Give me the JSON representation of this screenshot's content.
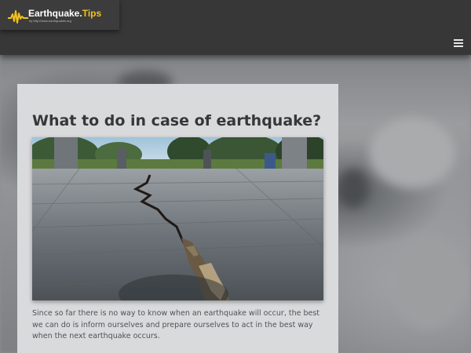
{
  "header": {
    "logo": {
      "title_main": "Earthquake.",
      "title_accent": "Tips",
      "subtitle": "by http://www.earthquakes.org"
    },
    "menu_icon": "hamburger-menu-icon"
  },
  "article": {
    "title": "What to do in case of earthquake?",
    "image_icon": "cracked-pavement-photo",
    "body": "Since so far there is no way to know when an earthquake will occur, the best we can do is inform ourselves and prepare ourselves to act in the best way when the next earthquake occurs."
  },
  "colors": {
    "header_bg": "#373737",
    "logo_accent": "#f3c11b",
    "card_bg": "#d9dadc",
    "title_text": "#353739",
    "body_text": "#4f5356"
  }
}
